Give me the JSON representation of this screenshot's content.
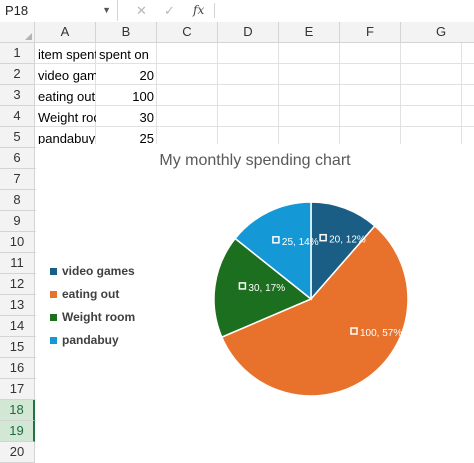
{
  "formula_bar": {
    "name_box": "P18",
    "cancel_icon": "✕",
    "enter_icon": "✓",
    "fx_label": "fx",
    "formula": ""
  },
  "columns": [
    "A",
    "B",
    "C",
    "D",
    "E",
    "F",
    "G"
  ],
  "rows": [
    "1",
    "2",
    "3",
    "4",
    "5",
    "6",
    "7",
    "8",
    "9",
    "10",
    "11",
    "12",
    "13",
    "14",
    "15",
    "16",
    "17",
    "18",
    "19",
    "20"
  ],
  "selected_rows": [
    "18",
    "19"
  ],
  "cells": {
    "A1": "item spent on",
    "B1": "spent on",
    "A2": "video games",
    "B2": "20",
    "A3": "eating out",
    "B3": "100",
    "A4": "Weight room",
    "B4": "30",
    "A5": "pandabuy",
    "B5": "25"
  },
  "colors": {
    "video_games": "#1a5e85",
    "eating_out": "#e8712c",
    "weight_room": "#1d6f20",
    "pandabuy": "#1498d6"
  },
  "chart_data": {
    "type": "pie",
    "title": "My monthly spending chart",
    "categories": [
      "video games",
      "eating out",
      "Weight room",
      "pandabuy"
    ],
    "values": [
      20,
      100,
      30,
      25
    ],
    "percent_labels": [
      "12%",
      "57%",
      "17%",
      "14%"
    ],
    "data_labels": [
      "20, 12%",
      "100, 57%",
      "30, 17%",
      "25, 14%"
    ],
    "legend_position": "left"
  }
}
